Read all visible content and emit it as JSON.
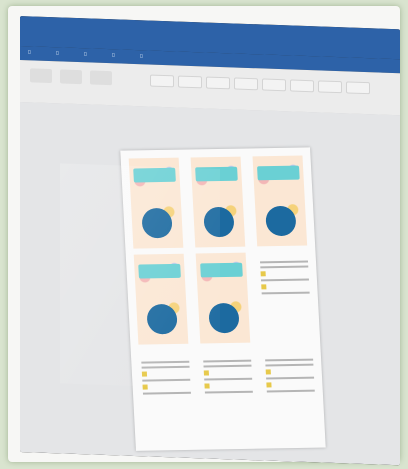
{
  "window": {
    "title": "",
    "accent_color": "#2d62a8"
  },
  "document": {
    "card_colors": {
      "banner": "#6ad0d4",
      "circle": "#1c6aa0",
      "background": "#fbe7d4"
    }
  }
}
